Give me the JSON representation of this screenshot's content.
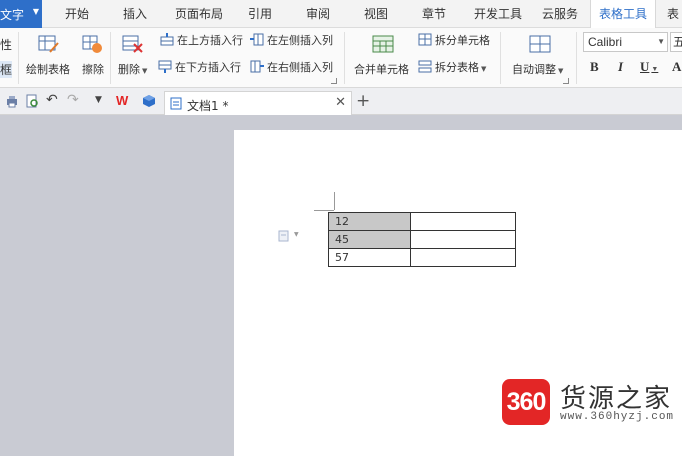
{
  "menubar": {
    "app_label": "文字",
    "items": [
      "开始",
      "插入",
      "页面布局",
      "引用",
      "审阅",
      "视图",
      "章节",
      "开发工具",
      "云服务",
      "表格工具",
      "表"
    ]
  },
  "ribbon": {
    "partial_left_top": "性",
    "partial_left_bottom": "框",
    "draw_table": "绘制表格",
    "eraser": "擦除",
    "delete": "删除",
    "insert_row_above": "在上方插入行",
    "insert_row_below": "在下方插入行",
    "insert_col_left": "在左侧插入列",
    "insert_col_right": "在右侧插入列",
    "merge_cells": "合并单元格",
    "split_cells": "拆分单元格",
    "split_table": "拆分表格",
    "auto_fit": "自动调整",
    "font_name": "Calibri",
    "font_size": "五",
    "bold": "B",
    "italic": "I",
    "underline": "U"
  },
  "tabbar": {
    "doc_title": "文档1 *"
  },
  "document": {
    "table_rows": [
      [
        "12",
        ""
      ],
      [
        "45",
        ""
      ],
      [
        "57",
        ""
      ]
    ]
  },
  "watermark": {
    "logo_text": "360",
    "site_name": "货源之家",
    "url": "www.360hyzj.com"
  },
  "colors": {
    "accent": "#2e6fc9",
    "wps_red": "#e32626",
    "logo_red": "#e32626"
  }
}
